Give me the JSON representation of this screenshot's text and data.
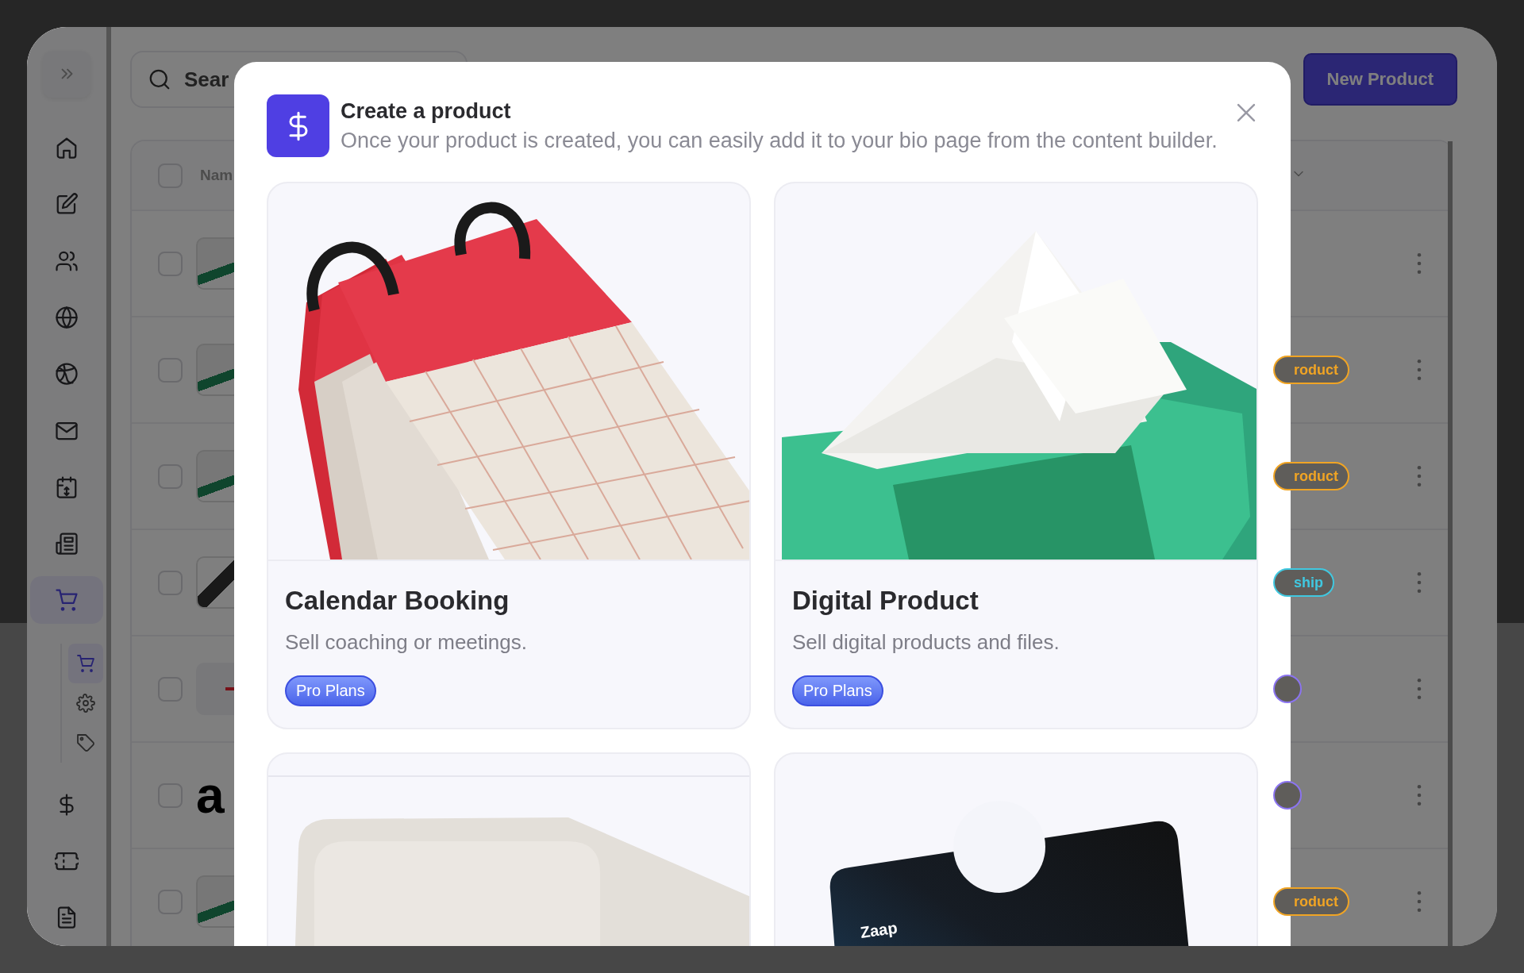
{
  "sidebar": {
    "items": [
      {
        "selected": false
      },
      {
        "selected": false
      },
      {
        "selected": false
      },
      {
        "selected": false
      },
      {
        "selected": false
      },
      {
        "selected": false
      },
      {
        "selected": false
      },
      {
        "selected": false
      },
      {
        "selected": true,
        "expanded": true,
        "children": [
          {
            "selected": true
          },
          {
            "selected": false
          },
          {
            "selected": false
          }
        ]
      },
      {
        "selected": false
      },
      {
        "selected": false
      },
      {
        "selected": false
      }
    ]
  },
  "search": {
    "placeholder": "Sear"
  },
  "new_button": "New Product",
  "table": {
    "all_checked": false,
    "columns": [
      {
        "label": "Nam"
      }
    ],
    "rows": [
      {
        "kind": "book",
        "checked": false
      },
      {
        "kind": "book",
        "checked": false,
        "badge": {
          "label": "roduct",
          "color": "#f0a424"
        }
      },
      {
        "kind": "book",
        "checked": false,
        "badge": {
          "label": "roduct",
          "color": "#f0a424"
        }
      },
      {
        "kind": "dark",
        "checked": false,
        "badge": {
          "label": "ship",
          "color": "#40c8e0"
        }
      },
      {
        "kind": "red",
        "checked": false,
        "badge": {
          "color": "#8b74f0"
        }
      },
      {
        "kind": "letter",
        "checked": false,
        "thumb_text": "a",
        "badge": {
          "color": "#8b74f0"
        }
      },
      {
        "kind": "book",
        "checked": false,
        "badge": {
          "label": "roduct",
          "color": "#f0a424"
        }
      }
    ]
  },
  "modal": {
    "title": "Create a product",
    "subtitle": "Once your product is created, you can easily add it to your bio page from the content builder.",
    "cards": [
      {
        "kind": "calendar",
        "title": "Calendar Booking",
        "description": "Sell coaching or meetings.",
        "badge": "Pro Plans"
      },
      {
        "kind": "tray",
        "title": "Digital Product",
        "description": "Sell digital products and files.",
        "badge": "Pro Plans"
      },
      {
        "kind": "box"
      },
      {
        "kind": "card",
        "image_text": "Zaap"
      }
    ]
  }
}
